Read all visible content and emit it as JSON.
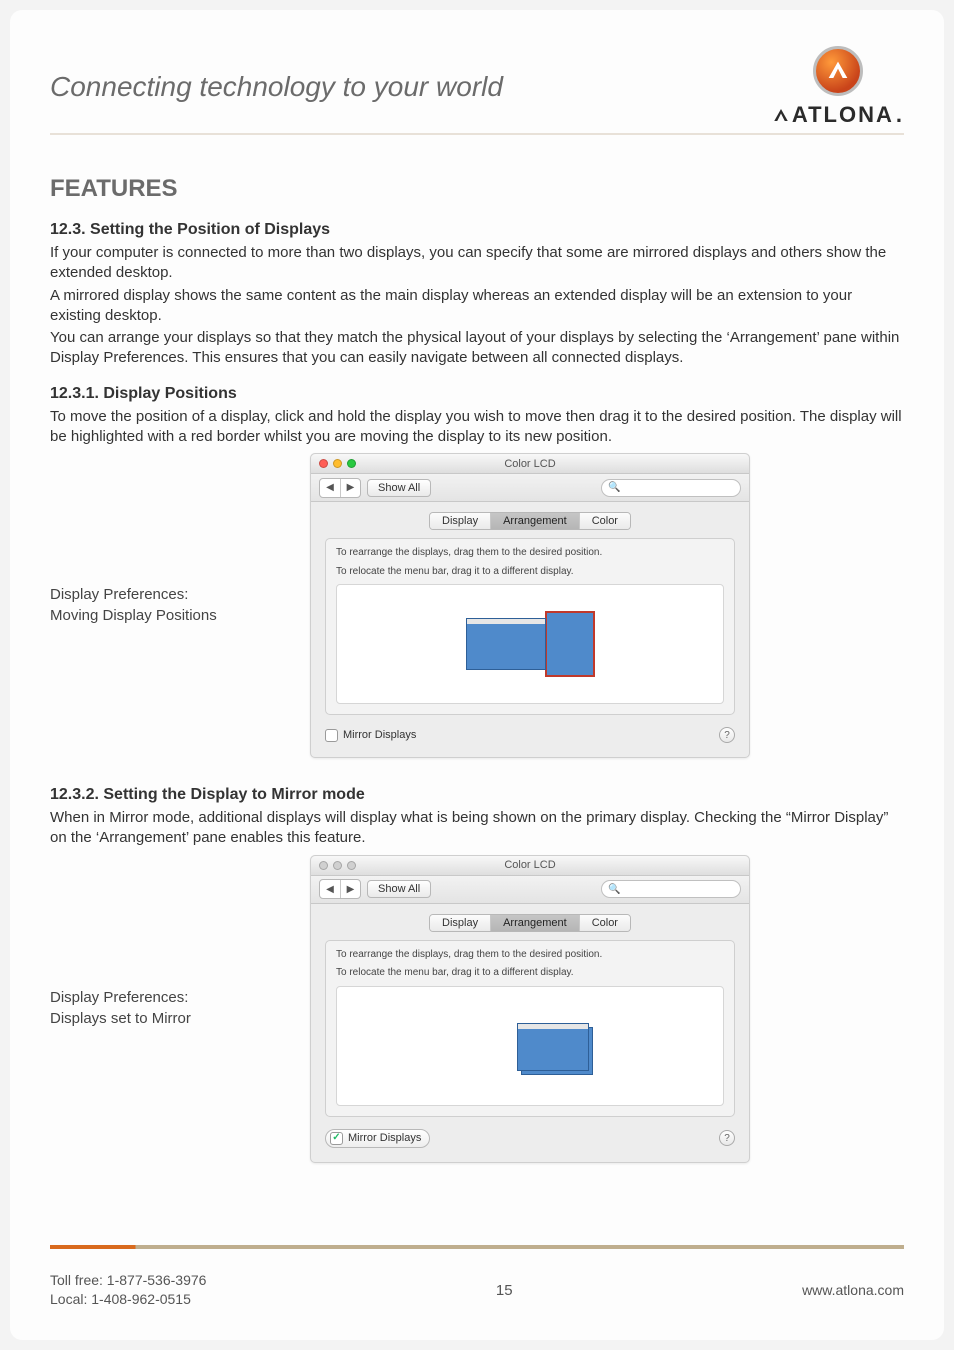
{
  "header": {
    "tagline": "Connecting technology to your world",
    "brand": "ATLONA"
  },
  "section": {
    "title": "FEATURES",
    "s12_3": {
      "heading": "12.3. Setting the Position of Displays",
      "p1": "If your computer is connected to more than two displays, you can specify that some are mirrored displays and others show the extended desktop.",
      "p2": "A mirrored display shows the same content as the main display whereas an extended display will be an extension to your existing desktop.",
      "p3": "You can arrange your displays so that they match the physical layout of your displays by selecting the ‘Arrangement’ pane within Display Preferences. This ensures that you can easily navigate between all connected displays."
    },
    "s12_3_1": {
      "heading": "12.3.1. Display Positions",
      "p1": "To move the position of a display, click and hold the display you wish to move then drag it to the desired position. The display will be highlighted with a red border whilst you are moving the display to its new position.",
      "caption_a": "Display Preferences:",
      "caption_b": "Moving Display Positions"
    },
    "s12_3_2": {
      "heading": "12.3.2. Setting the Display to Mirror mode",
      "p1": "When in Mirror mode, additional displays will display what is being shown on the primary display. Checking the “Mirror Display” on the ‘Arrangement’ pane enables this feature.",
      "caption_a": "Display Preferences:",
      "caption_b": "Displays set to Mirror"
    }
  },
  "macwin": {
    "title": "Color LCD",
    "show_all": "Show All",
    "tabs": {
      "display": "Display",
      "arrangement": "Arrangement",
      "color": "Color"
    },
    "instr1": "To rearrange the displays, drag them to the desired position.",
    "instr2": "To relocate the menu bar, drag it to a different display.",
    "mirror_label": "Mirror Displays",
    "help": "?",
    "search_icon_glyph": "🔍"
  },
  "footer": {
    "toll": "Toll free: 1-877-536-3976",
    "local": "Local: 1-408-962-0515",
    "page": "15",
    "url": "www.atlona.com"
  }
}
